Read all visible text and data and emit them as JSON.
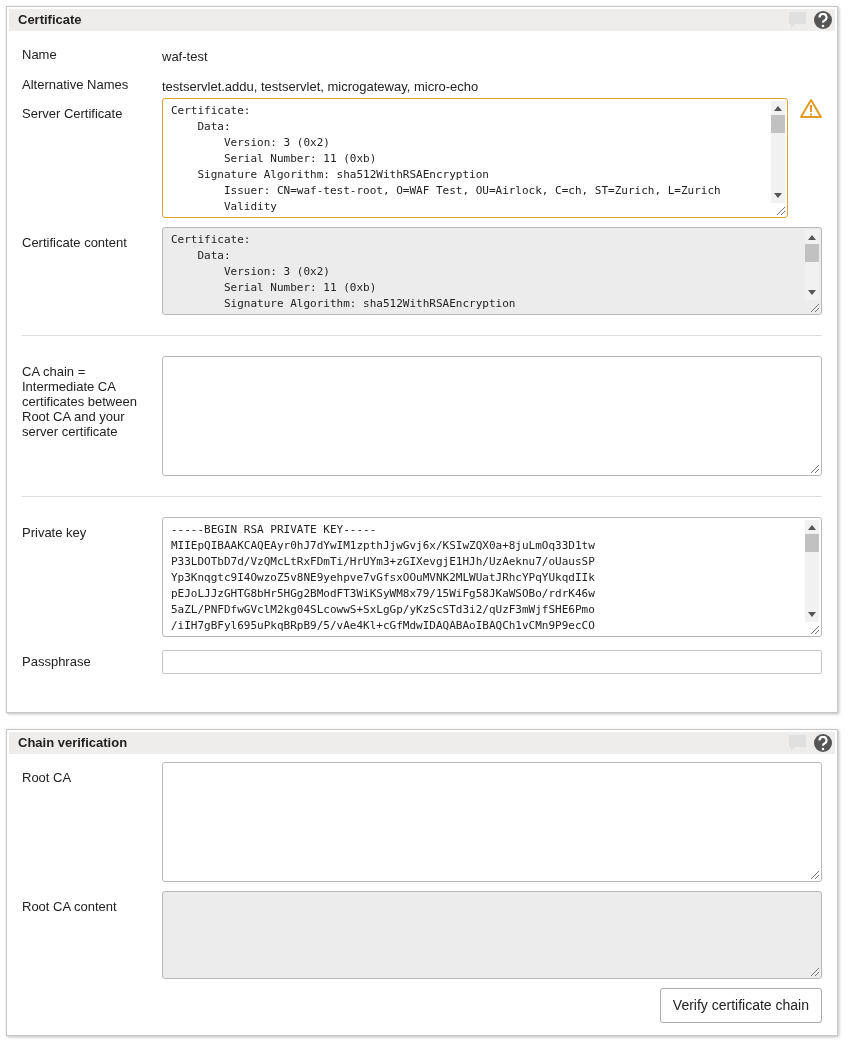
{
  "panels": [
    {
      "title": "Certificate",
      "rows": [
        {
          "kind": "text",
          "label": "Name",
          "value": "waf-test"
        },
        {
          "kind": "text",
          "label": "Alternative Names",
          "value": "testservlet.addu, testservlet, microgateway, micro-echo"
        },
        {
          "kind": "textarea",
          "label": "Server Certificate",
          "readonly": false,
          "warning": true,
          "lines": [
            "Certificate:",
            "    Data:",
            "        Version: 3 (0x2)",
            "        Serial Number: 11 (0xb)",
            "    Signature Algorithm: sha512WithRSAEncryption",
            "        Issuer: CN=waf-test-root, O=WAF Test, OU=Airlock, C=ch, ST=Zurich, L=Zurich",
            "        Validity"
          ]
        },
        {
          "kind": "textarea",
          "label": "Certificate content",
          "readonly": true,
          "warning": false,
          "lines": [
            "Certificate:",
            "    Data:",
            "        Version: 3 (0x2)",
            "        Serial Number: 11 (0xb)",
            "        Signature Algorithm: sha512WithRSAEncryption"
          ]
        },
        {
          "kind": "divider"
        },
        {
          "kind": "textarea",
          "label": "CA chain = Intermediate CA certificates between Root CA and your server certificate",
          "readonly": false,
          "warning": false,
          "lines": []
        },
        {
          "kind": "divider"
        },
        {
          "kind": "textarea",
          "label": "Private key",
          "readonly": false,
          "warning": false,
          "lines": [
            "-----BEGIN RSA PRIVATE KEY-----",
            "MIIEpQIBAAKCAQEAyr0hJ7dYwIM1zpthJjwGvj6x/KSIwZQX0a+8juLmOq33D1tw",
            "P33LDOTbD7d/VzQMcLtRxFDmTi/HrUYm3+zGIXevgjE1HJh/UzAeknu7/oUausSP",
            "Yp3Knqgtc9I4OwzoZ5v8NE9yehpve7vGfsxOOuMVNK2MLWUatJRhcYPqYUkqdIIk",
            "pEJoLJJzGHTG8bHr5HGg2BModFT3WiKSyWM8x79/15WiFg58JKaWSOBo/rdrK46w",
            "5aZL/PNFDfwGVclM2kg04SLcowwS+SxLgGp/yKzScSTd3i2/qUzF3mWjfSHE6Pmo",
            "/iIH7gBFyl695uPkqBRpB9/5/vAe4Kl+cGfMdwIDAQABAoIBAQCh1vCMn9P9ecCO"
          ]
        },
        {
          "kind": "input",
          "label": "Passphrase"
        }
      ]
    },
    {
      "title": "Chain verification",
      "rows": [
        {
          "kind": "textarea",
          "label": "Root CA",
          "readonly": false,
          "warning": false,
          "lines": []
        },
        {
          "kind": "textarea",
          "label": "Root CA content",
          "readonly": true,
          "warning": false,
          "lines": []
        }
      ],
      "button": "Verify certificate chain"
    }
  ]
}
